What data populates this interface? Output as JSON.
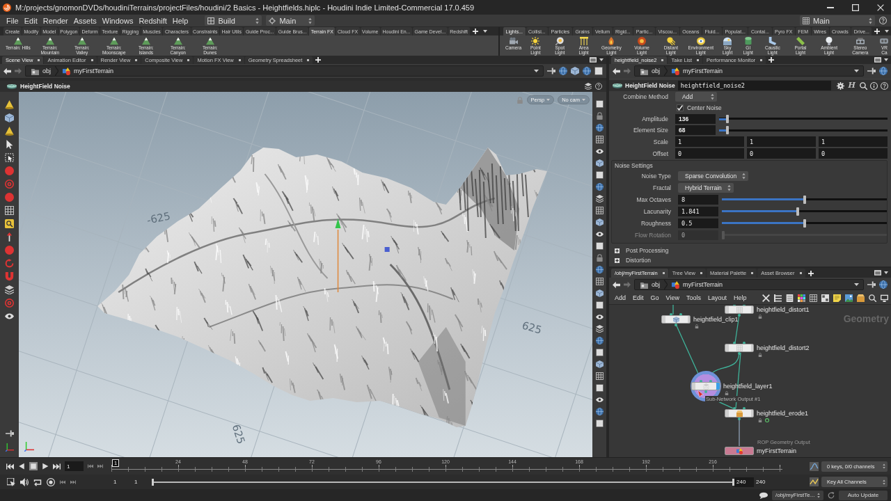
{
  "window": {
    "title": "M:/projects/gnomonDVDs/houdiniTerrains/projectFiles/houdini/2 Basics - Heightfields.hiplc - Houdini Indie Limited-Commercial 17.0.459"
  },
  "menu_bar": {
    "items": [
      "File",
      "Edit",
      "Render",
      "Assets",
      "Windows",
      "Redshift",
      "Help"
    ],
    "desktop": "Build",
    "context": "Main",
    "right_context": "Main"
  },
  "shelves": [
    {
      "tabs": [
        {
          "label": "Create",
          "selected": false
        },
        {
          "label": "Modify",
          "selected": false
        },
        {
          "label": "Model",
          "selected": false
        },
        {
          "label": "Polygon",
          "selected": false
        },
        {
          "label": "Deform",
          "selected": false
        },
        {
          "label": "Texture",
          "selected": false
        },
        {
          "label": "Rigging",
          "selected": false
        },
        {
          "label": "Muscles",
          "selected": false
        },
        {
          "label": "Characters",
          "selected": false
        },
        {
          "label": "Constraints",
          "selected": false
        },
        {
          "label": "Hair Utils",
          "selected": false
        },
        {
          "label": "Guide Proc...",
          "selected": false
        },
        {
          "label": "Guide Brus...",
          "selected": false
        },
        {
          "label": "Terrain FX",
          "selected": true
        },
        {
          "label": "Cloud FX",
          "selected": false
        },
        {
          "label": "Volume",
          "selected": false
        },
        {
          "label": "Houdini En...",
          "selected": false
        },
        {
          "label": "Game Devel...",
          "selected": false
        },
        {
          "label": "Redshift",
          "selected": false
        }
      ],
      "tools": [
        {
          "label": "Terrain: Hills"
        },
        {
          "label": "Terrain: Mountain"
        },
        {
          "label": "Terrain: Valley"
        },
        {
          "label": "Terrain: Moonscape"
        },
        {
          "label": "Terrain: Islands"
        },
        {
          "label": "Terrain: Canyon"
        },
        {
          "label": "Terrain: Dunes"
        }
      ]
    },
    {
      "tabs": [
        {
          "label": "Lights...",
          "selected": true
        },
        {
          "label": "Collisi...",
          "selected": false
        },
        {
          "label": "Particles",
          "selected": false
        },
        {
          "label": "Grains",
          "selected": false
        },
        {
          "label": "Vellum",
          "selected": false
        },
        {
          "label": "Rigid...",
          "selected": false
        },
        {
          "label": "Partic...",
          "selected": false
        },
        {
          "label": "Viscou...",
          "selected": false
        },
        {
          "label": "Oceans",
          "selected": false
        },
        {
          "label": "Fluid...",
          "selected": false
        },
        {
          "label": "Populat...",
          "selected": false
        },
        {
          "label": "Contai...",
          "selected": false
        },
        {
          "label": "Pyro FX",
          "selected": false
        },
        {
          "label": "FEM",
          "selected": false
        },
        {
          "label": "Wires",
          "selected": false
        },
        {
          "label": "Crowds",
          "selected": false
        },
        {
          "label": "Drive...",
          "selected": false
        }
      ],
      "tools": [
        {
          "label": "Camera"
        },
        {
          "label": "Point Light"
        },
        {
          "label": "Spot Light"
        },
        {
          "label": "Area Light"
        },
        {
          "label": "Geometry Light"
        },
        {
          "label": "Volume Light"
        },
        {
          "label": "Distant Light"
        },
        {
          "label": "Environment Light"
        },
        {
          "label": "Sky Light"
        },
        {
          "label": "GI Light"
        },
        {
          "label": "Caustic Light"
        },
        {
          "label": "Portal Light"
        },
        {
          "label": "Ambient Light"
        },
        {
          "label": "Stereo Camera"
        },
        {
          "label": "VR Ca"
        }
      ]
    }
  ],
  "scene_pane": {
    "tabs": [
      {
        "label": "Scene View",
        "selected": true
      },
      {
        "label": "Animation Editor",
        "selected": false
      },
      {
        "label": "Render View",
        "selected": false
      },
      {
        "label": "Composite View",
        "selected": false
      },
      {
        "label": "Motion FX View",
        "selected": false
      },
      {
        "label": "Geometry Spreadsheet",
        "selected": false
      }
    ],
    "path": [
      "obj",
      "myFirstTerrain"
    ],
    "viewport": {
      "title": "HeightField Noise",
      "camera_menus": [
        "Persp",
        "No cam"
      ],
      "grid_labels": [
        "-625",
        "625",
        "625"
      ]
    }
  },
  "parameter_pane": {
    "tabs": [
      {
        "label": "heightfield_noise2",
        "selected": true
      },
      {
        "label": "Take List",
        "selected": false
      },
      {
        "label": "Performance Monitor",
        "selected": false
      }
    ],
    "path": [
      "obj",
      "myFirstTerrain"
    ],
    "node_type": "HeightField Noise",
    "node_name": "heightfield_noise2",
    "help_glyph": "H",
    "parameters": [
      {
        "kind": "menu",
        "label": "Combine Method",
        "value": "Add"
      },
      {
        "kind": "checkbox",
        "label": "Center Noise",
        "checked": true
      },
      {
        "kind": "slider",
        "label": "Amplitude",
        "value": "136",
        "level": 0.05,
        "modified": true,
        "disabled": false
      },
      {
        "kind": "slider",
        "label": "Element Size",
        "value": "68",
        "level": 0.05,
        "modified": true,
        "disabled": false
      },
      {
        "kind": "vector",
        "label": "Scale",
        "values": [
          "1",
          "1",
          "1"
        ]
      },
      {
        "kind": "vector",
        "label": "Offset",
        "values": [
          "0",
          "0",
          "0"
        ]
      }
    ],
    "noise_settings": {
      "title": "Noise Settings",
      "parameters": [
        {
          "kind": "menu",
          "label": "Noise Type",
          "value": "Sparse Convolution"
        },
        {
          "kind": "menu",
          "label": "Fractal",
          "value": "Hybrid Terrain"
        },
        {
          "kind": "slider",
          "label": "Max Octaves",
          "value": "8",
          "level": 0.5,
          "modified": false,
          "disabled": false
        },
        {
          "kind": "slider",
          "label": "Lacunarity",
          "value": "1.841",
          "level": 0.46,
          "modified": false,
          "disabled": false
        },
        {
          "kind": "slider",
          "label": "Roughness",
          "value": "0.5",
          "level": 0.5,
          "modified": false,
          "disabled": false
        },
        {
          "kind": "slider",
          "label": "Flow Rotation",
          "value": "0",
          "level": 0,
          "modified": false,
          "disabled": true
        }
      ]
    },
    "folders": [
      {
        "label": "Post Processing",
        "expanded": false
      },
      {
        "label": "Distortion",
        "expanded": false
      }
    ]
  },
  "network_pane": {
    "tabs": [
      {
        "label": "/obj/myFirstTerrain",
        "selected": true
      },
      {
        "label": "Tree View",
        "selected": false
      },
      {
        "label": "Material Palette",
        "selected": false
      },
      {
        "label": "Asset Browser",
        "selected": false
      }
    ],
    "path": [
      "obj",
      "myFirstTerrain"
    ],
    "menu": [
      "Add",
      "Edit",
      "Go",
      "View",
      "Tools",
      "Layout",
      "Help"
    ],
    "context_label": "Geometry",
    "connector_label": "Sub-Network Output #1",
    "nodes": [
      {
        "name": "heightfield_distort1",
        "kind": "distort",
        "selected": false,
        "time_dependent": false
      },
      {
        "name": "heightfield_clip1",
        "kind": "clip",
        "selected": false,
        "time_dependent": false
      },
      {
        "name": "heightfield_distort2",
        "kind": "distort",
        "selected": false,
        "time_dependent": false
      },
      {
        "name": "heightfield_layer1",
        "kind": "layer",
        "selected": true,
        "time_dependent": false
      },
      {
        "name": "heightfield_erode1",
        "kind": "erode",
        "selected": false,
        "time_dependent": true
      },
      {
        "name": "myFirstTerrain",
        "kind": "output",
        "type_label": "ROP Geometry Output",
        "selected": false,
        "time_dependent": false
      }
    ]
  },
  "timeline": {
    "current_frame": "1",
    "frame_marker": "1",
    "ruler_labels": [
      "24",
      "48",
      "72",
      "96",
      "120",
      "144",
      "168",
      "192",
      "216"
    ],
    "range_start": "1",
    "visible_start": "1",
    "visible_end": "240",
    "range_end": "240",
    "keys_info": "0 keys, 0/0 channels",
    "key_menu": "Key All Channels"
  },
  "status_bar": {
    "path": "/obj/myFirstTe...",
    "update_mode": "Auto Update"
  }
}
